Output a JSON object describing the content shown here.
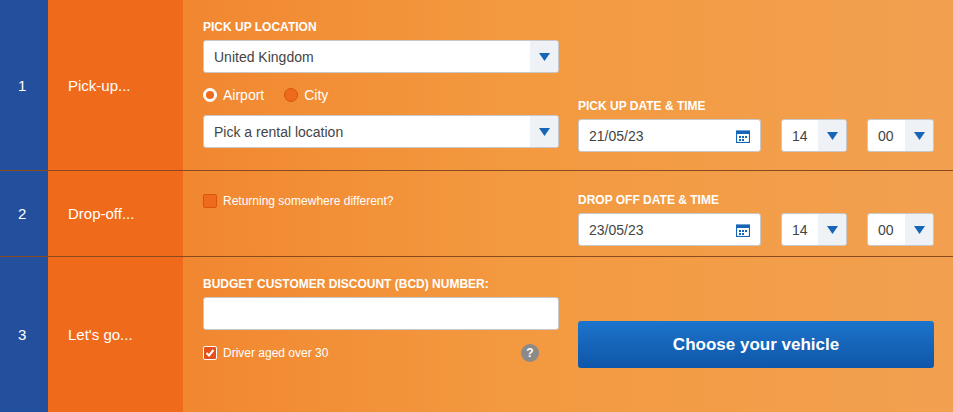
{
  "steps": [
    {
      "number": "1",
      "label": "Pick-up..."
    },
    {
      "number": "2",
      "label": "Drop-off..."
    },
    {
      "number": "3",
      "label": "Let's go..."
    }
  ],
  "pickup": {
    "location_label": "PICK UP LOCATION",
    "country": "United Kingdom",
    "location_types": [
      {
        "label": "Airport",
        "selected": true
      },
      {
        "label": "City",
        "selected": false
      }
    ],
    "rental_location_placeholder": "Pick a rental location",
    "datetime_label": "PICK UP DATE & TIME",
    "date": "21/05/23",
    "hour": "14",
    "minute": "00"
  },
  "dropoff": {
    "return_different": {
      "label": "Returning somewhere different?",
      "checked": false
    },
    "datetime_label": "DROP OFF DATE & TIME",
    "date": "23/05/23",
    "hour": "14",
    "minute": "00"
  },
  "go": {
    "bcd_label": "BUDGET CUSTOMER DISCOUNT (BCD) NUMBER:",
    "bcd_value": "",
    "driver_over_30": {
      "label": "Driver aged over 30",
      "checked": true
    },
    "help": "?",
    "button": "Choose your vehicle"
  }
}
